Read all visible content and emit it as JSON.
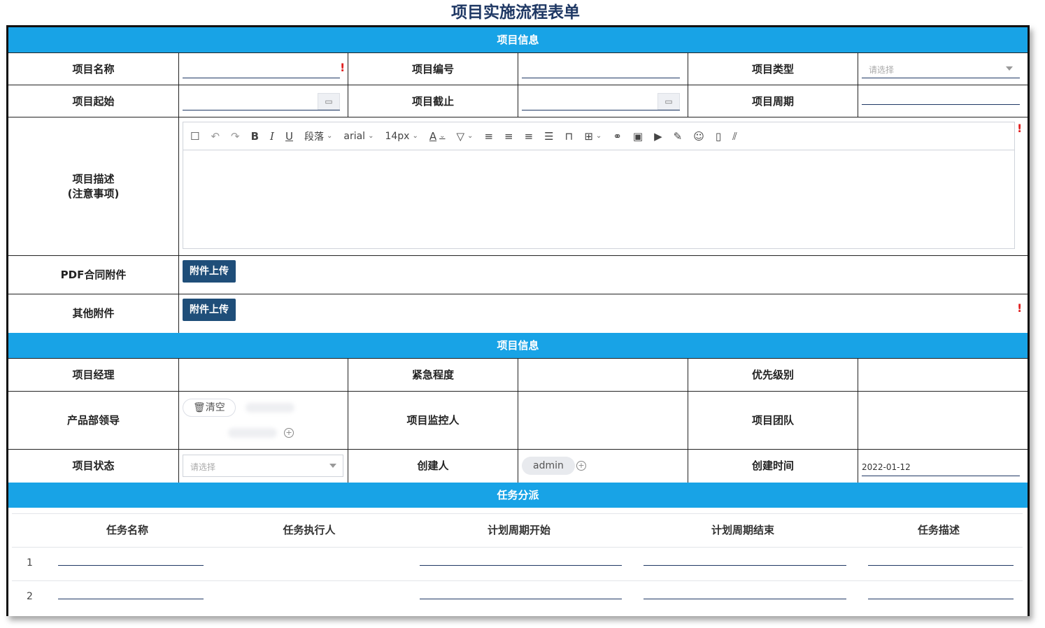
{
  "title": "项目实施流程表单",
  "sections": {
    "project_info": "项目信息",
    "project_info_2": "项目信息",
    "task_assign": "任务分派"
  },
  "labels": {
    "name": "项目名称",
    "number": "项目编号",
    "type": "项目类型",
    "start": "项目起始",
    "end": "项目截止",
    "period": "项目周期",
    "desc_line1": "项目描述",
    "desc_line2": "(注意事项)",
    "pdf_attach": "PDF合同附件",
    "other_attach": "其他附件",
    "manager": "项目经理",
    "urgency": "紧急程度",
    "priority": "优先级别",
    "product_lead": "产品部领导",
    "monitor": "项目监控人",
    "team": "项目团队",
    "status": "项目状态",
    "creator": "创建人",
    "created_time": "创建时间"
  },
  "placeholders": {
    "type_select": "请选择",
    "status_select": "请选择"
  },
  "buttons": {
    "upload": "附件上传",
    "upload_2": "附件上传",
    "clear": "清空"
  },
  "values": {
    "creator": "admin",
    "created_time": "2022-01-12"
  },
  "required_mark": "!",
  "toolbar": {
    "paragraph": "段落",
    "font": "arial",
    "size": "14px"
  },
  "task_table": {
    "headers": [
      "任务名称",
      "任务执行人",
      "计划周期开始",
      "计划周期结束",
      "任务描述"
    ],
    "rows": [
      "1",
      "2"
    ]
  },
  "colors": {
    "band": "#18a3e6",
    "button": "#1f4e79",
    "title": "#1f3864",
    "required": "#e02020"
  }
}
